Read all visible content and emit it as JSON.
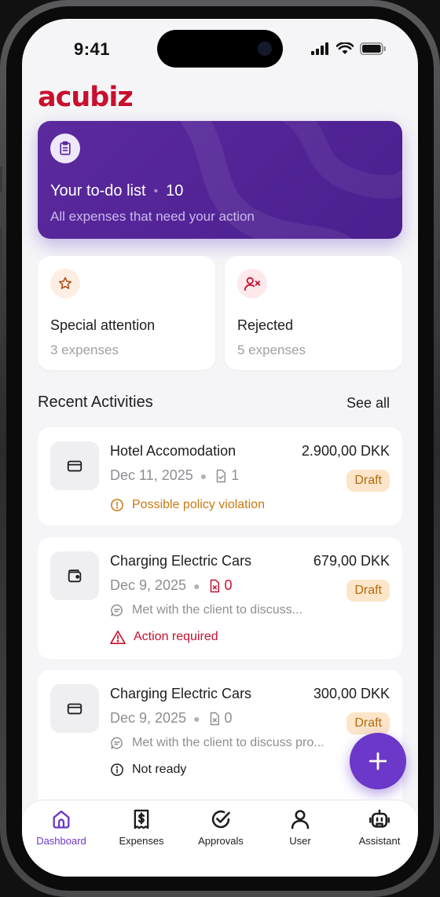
{
  "status_bar": {
    "time": "9:41"
  },
  "brand": {
    "logo_text": "acubiz",
    "color": "#c8102e"
  },
  "todo": {
    "title": "Your to-do list",
    "separator": "•",
    "count": "10",
    "subtitle": "All expenses that need your action",
    "icon": "clipboard-icon",
    "colors": {
      "from": "#5b2a9e",
      "to": "#4a1f8e"
    }
  },
  "quick_cards": [
    {
      "title": "Special attention",
      "subtitle": "3 expenses",
      "icon": "star-icon"
    },
    {
      "title": "Rejected",
      "subtitle": "5 expenses",
      "icon": "user-x-icon"
    }
  ],
  "recent": {
    "title": "Recent Activities",
    "see_all": "See all",
    "items": [
      {
        "title": "Hotel Accomodation",
        "amount": "2.900,00 DKK",
        "date": "Dec 11, 2025",
        "attachments": "1",
        "status_badge": "Draft",
        "note": "",
        "flag": "Possible policy violation",
        "flag_color": "#c77a12",
        "icon": "credit-card-icon"
      },
      {
        "title": "Charging Electric Cars",
        "amount": "679,00 DKK",
        "date": "Dec 9, 2025",
        "attachments": "0",
        "status_badge": "Draft",
        "note": "Met with the client to discuss...",
        "flag": "Action required",
        "flag_color": "#c8102e",
        "icon": "wallet-icon"
      },
      {
        "title": "Charging Electric Cars",
        "amount": "300,00 DKK",
        "date": "Dec 9, 2025",
        "attachments": "0",
        "status_badge": "Draft",
        "note": "Met with the client to discuss pro...",
        "flag": "Not ready",
        "flag_color": "#1d1d1f",
        "icon": "credit-card-icon"
      }
    ]
  },
  "fab": {
    "icon": "plus-icon"
  },
  "tabbar": {
    "items": [
      {
        "label": "Dashboard",
        "icon": "home-icon",
        "active": true
      },
      {
        "label": "Expenses",
        "icon": "receipt-icon",
        "active": false
      },
      {
        "label": "Approvals",
        "icon": "check-circle-icon",
        "active": false
      },
      {
        "label": "User",
        "icon": "user-icon",
        "active": false
      },
      {
        "label": "Assistant",
        "icon": "robot-icon",
        "active": false
      }
    ],
    "accent": "#6b38c9"
  }
}
